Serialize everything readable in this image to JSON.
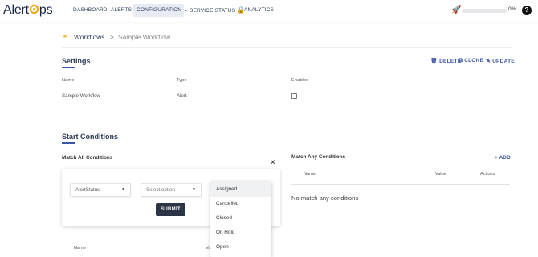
{
  "app": {
    "logo_text_left": "Alert",
    "logo_text_right": "ps"
  },
  "nav": {
    "items": [
      {
        "label": "DASHBOARD"
      },
      {
        "label": "ALERTS"
      },
      {
        "label": "CONFIGURATION"
      },
      {
        "label": "SERVICE STATUS"
      },
      {
        "label": "ANALYTICS"
      }
    ]
  },
  "progress": {
    "value": 0,
    "text": "0%"
  },
  "help": {
    "label": "?"
  },
  "breadcrumb": {
    "root": "Workflows",
    "separator": ">",
    "current": "Sample Workflow"
  },
  "settings": {
    "title": "Settings",
    "actions": {
      "delete": "DELETE",
      "clone": "CLONE",
      "update": "UPDATE"
    },
    "columns": {
      "name": "Name",
      "type": "Type",
      "enabled": "Enabled"
    },
    "row": {
      "name": "Sample Workflow",
      "type": "Alert",
      "enabled": false
    }
  },
  "start_conditions": {
    "title": "Start Conditions",
    "match_all": {
      "title": "Match All Conditions",
      "field_select": "AlertStatus",
      "operator_select": "Select option",
      "submit": "SUBMIT",
      "dropdown_options": [
        "Assigned",
        "Cancelled",
        "Closed",
        "On Hold",
        "Open"
      ],
      "highlighted_option": "Assigned",
      "table_columns": {
        "name": "Name",
        "value": "Va"
      }
    },
    "match_any": {
      "title": "Match Any Conditions",
      "add": "+ ADD",
      "columns": {
        "name": "Name",
        "value": "Value",
        "actions": "Actions"
      },
      "empty": "No match any conditions"
    }
  },
  "colors": {
    "accent": "#3d57a8",
    "brand_orange": "#f0a81c",
    "dark": "#2b3547"
  }
}
